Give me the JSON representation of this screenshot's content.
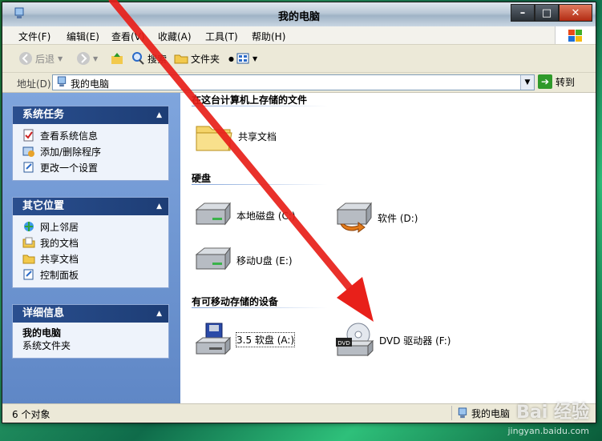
{
  "window": {
    "title": "我的电脑"
  },
  "menu": [
    "文件(F)",
    "编辑(E)",
    "查看(V)",
    "收藏(A)",
    "工具(T)",
    "帮助(H)"
  ],
  "toolbar": {
    "back": "后退",
    "search": "搜索",
    "folders": "文件夹"
  },
  "address": {
    "label": "地址(D)",
    "value": "我的电脑",
    "go": "转到"
  },
  "left": {
    "tasks": {
      "title": "系统任务",
      "items": [
        "查看系统信息",
        "添加/删除程序",
        "更改一个设置"
      ]
    },
    "places": {
      "title": "其它位置",
      "items": [
        "网上邻居",
        "我的文档",
        "共享文档",
        "控制面板"
      ]
    },
    "details": {
      "title": "详细信息",
      "name": "我的电脑",
      "desc": "系统文件夹"
    }
  },
  "content": {
    "sec_files": "在这台计算机上存储的文件",
    "shared_docs": "共享文档",
    "sec_disks": "硬盘",
    "disk_c": "本地磁盘 (C:)",
    "disk_d": "软件 (D:)",
    "disk_e": "移动U盘 (E:)",
    "sec_removable": "有可移动存储的设备",
    "floppy": "3.5 软盘 (A:)",
    "dvd": "DVD 驱动器 (F:)"
  },
  "status": {
    "left": "6 个对象",
    "right": "我的电脑"
  },
  "watermark": {
    "brand": "Bai 经验",
    "url": "jingyan.baidu.com"
  },
  "colors": {
    "arrow": "#e8201a",
    "panel_header": "#2a4f8f",
    "left_pane": "#6f96d2"
  }
}
